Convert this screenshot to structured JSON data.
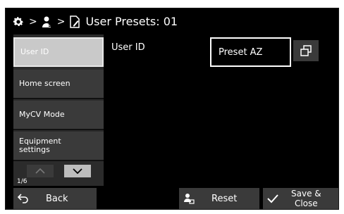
{
  "header": {
    "title": "User Presets: 01",
    "icons": [
      "gear-icon",
      "user-settings-icon",
      "edit-document-icon"
    ],
    "separator": ">"
  },
  "sidebar": {
    "items": [
      {
        "label": "User ID",
        "active": true
      },
      {
        "label": "Home screen",
        "active": false
      },
      {
        "label": "MyCV Mode",
        "active": false
      },
      {
        "label": "Equipment\nsettings",
        "active": false
      }
    ],
    "page_indicator": "1/6"
  },
  "main": {
    "row_label": "User ID",
    "preset_value": "Preset AZ",
    "popup_icon": "window-popup-icon"
  },
  "footer": {
    "back_label": "Back",
    "reset_label": "Reset",
    "save_label": "Save &\nClose"
  },
  "colors": {
    "background": "#000000",
    "panel": "#3a3a3a",
    "active": "#c9c9c9",
    "text": "#ffffff"
  }
}
